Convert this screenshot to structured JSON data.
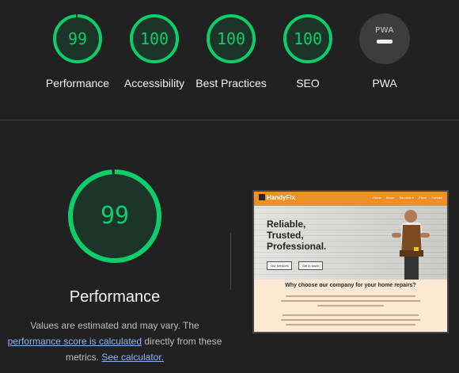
{
  "categories": [
    {
      "label": "Performance",
      "score": "99",
      "value": 99
    },
    {
      "label": "Accessibility",
      "score": "100",
      "value": 100
    },
    {
      "label": "Best Practices",
      "score": "100",
      "value": 100
    },
    {
      "label": "SEO",
      "score": "100",
      "value": 100
    }
  ],
  "pwa": {
    "label": "PWA",
    "badge_text": "PWA"
  },
  "performance": {
    "score": "99",
    "value": 99,
    "title": "Performance",
    "desc_prefix": "Values are estimated and may vary. The",
    "desc_link": "performance score is calculated",
    "desc_middle": "directly from these metrics.",
    "desc_calc_link": "See calculator."
  },
  "screenshot": {
    "logo": "HandyFix",
    "nav_links": [
      "Home",
      "About",
      "Services ▾",
      "Plans",
      "Contact"
    ],
    "hero_lines": [
      "Reliable,",
      "Trusted,",
      "Professional."
    ],
    "buttons": [
      "Our services",
      "Get in touch"
    ],
    "heading": "Why choose our company for your home repairs?"
  },
  "colors": {
    "pass": "#0cce6b",
    "pass_bg": "#1d3428",
    "brand": "#ef8f28",
    "link": "#8ab4f8"
  }
}
